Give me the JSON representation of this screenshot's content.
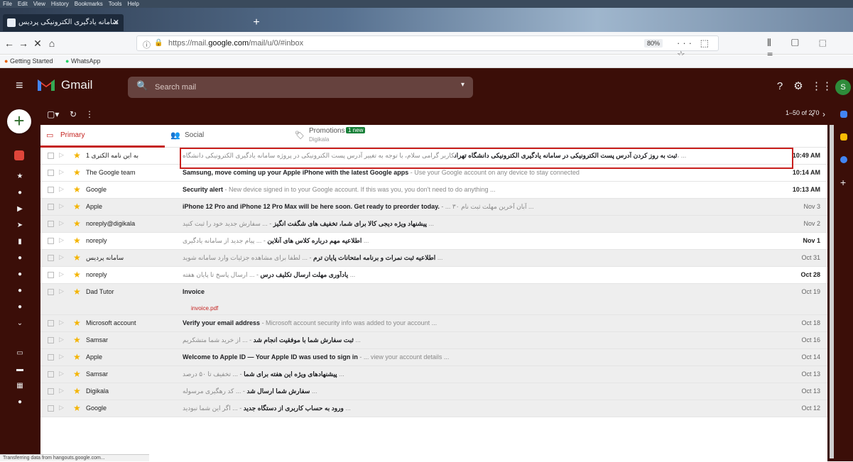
{
  "browser": {
    "menu": [
      "File",
      "Edit",
      "View",
      "History",
      "Bookmarks",
      "Tools",
      "Help"
    ],
    "tab_title": "سامانه یادگیری الکترونیکی پردیس",
    "tab_close": "✕",
    "new_tab": "+",
    "url_prefix": "https://mail.",
    "url_domain": "google.com",
    "url_suffix": "/mail/u/0/#inbox",
    "zoom": "80%",
    "url_icons": "··· ⬚ ☆",
    "right_icons": "⫴ ▢ ⬚ ≡",
    "bookmarks": [
      "Getting Started",
      "WhatsApp"
    ]
  },
  "gmail": {
    "app_name": "Gmail",
    "search_placeholder": "Search mail",
    "search_options": "▾",
    "avatar_letter": "S",
    "compose_label": "+",
    "toolbar": {
      "refresh": "↻",
      "more": "⋮",
      "select": "▢▾"
    },
    "pager": "1–50 of 270",
    "tabs": [
      {
        "label": "Primary",
        "icon": "▭"
      },
      {
        "label": "Social",
        "icon": "👥"
      },
      {
        "label": "Promotions",
        "icon": "🏷",
        "badge": "1 new",
        "sub": "Digikala"
      }
    ],
    "rows": [
      {
        "from": "1 به این نامه الکتری",
        "subject": "ثبت به روز کردن آدرس پست الکترونیکی در سامانه یادگیری الکترونیکی دانشگاه تهران",
        "snippet": "کاربر گرامی سلام، با توجه به تغییر آدرس پست الکترونیکی در پروژه سامانه یادگیری الکترونیکی دانشگاه، ...",
        "date": "10:49 AM",
        "read": false
      },
      {
        "from": "The Google team",
        "subject": "Samsung, move coming up your Apple iPhone with the latest Google apps",
        "snippet": " - Use your Google account on any device to stay connected",
        "date": "10:14 AM",
        "read": false
      },
      {
        "from": "Google",
        "subject": "Security alert",
        "snippet": " - New device signed in to your Google account. If this was you, you don't need to do anything ...",
        "date": "10:13 AM",
        "read": false
      },
      {
        "from": "Apple",
        "subject": "iPhone 12 Pro and iPhone 12 Pro Max will be here soon. Get ready to preorder today.",
        "snippet": " - ... ۳۰ آبان آخرین مهلت ثبت نام ...",
        "date": "Nov 3",
        "read": true
      },
      {
        "from": "noreply@digikala",
        "subject": "پیشنهاد ویژه دیجی کالا برای شما، تخفیف های شگفت انگیز",
        "snippet": " - ... سفارش جدید خود را ثبت کنید ...",
        "date": "Nov 2",
        "read": true
      },
      {
        "from": "noreply",
        "subject": "اطلاعیه مهم درباره کلاس های آنلاین",
        "snippet": " - ... پیام جدید از سامانه یادگیری ... ",
        "date": "Nov 1",
        "read": false
      },
      {
        "from": "سامانه پردیس",
        "subject": "اطلاعیه ثبت نمرات و برنامه امتحانات پایان ترم",
        "snippet": " - ... لطفا برای مشاهده جزئیات وارد سامانه شوید ...",
        "date": "Oct 31",
        "read": true
      },
      {
        "from": "noreply",
        "subject": "یادآوری مهلت ارسال تکلیف درس",
        "snippet": " - ... ارسال پاسخ تا پایان هفته ...",
        "date": "Oct 28",
        "read": false
      },
      {
        "from": "Dad Tutor",
        "subject": "Invoice",
        "snippet": "",
        "date": "Oct 19",
        "read": true,
        "attachment": "invoice.pdf"
      },
      {
        "from": "Microsoft account",
        "subject": "Verify your email address",
        "snippet": " - Microsoft account security info was added to your account ...",
        "date": "Oct 18",
        "read": true
      },
      {
        "from": "Samsar",
        "subject": "ثبت سفارش شما با موفقیت انجام شد",
        "snippet": " - ... از خرید شما متشکریم ...",
        "date": "Oct 16",
        "read": true
      },
      {
        "from": "Apple",
        "subject": "Welcome to Apple ID — Your Apple ID was used to sign in",
        "snippet": " - ... view your account details ...",
        "date": "Oct 14",
        "read": true
      },
      {
        "from": "Samsar",
        "subject": "پیشنهادهای ویژه این هفته برای شما",
        "snippet": " - ... تخفیف تا ۵۰ درصد ...",
        "date": "Oct 13",
        "read": true
      },
      {
        "from": "Digikala",
        "subject": "سفارش شما ارسال شد",
        "snippet": " - ... کد رهگیری مرسوله ...",
        "date": "Oct 13",
        "read": true
      },
      {
        "from": "Google",
        "subject": "ورود به حساب کاربری از دستگاه جدید",
        "snippet": " - ... اگر این شما نبودید ...",
        "date": "Oct 12",
        "read": true
      }
    ]
  },
  "statusbar": "Transferring data from hangouts.google.com..."
}
